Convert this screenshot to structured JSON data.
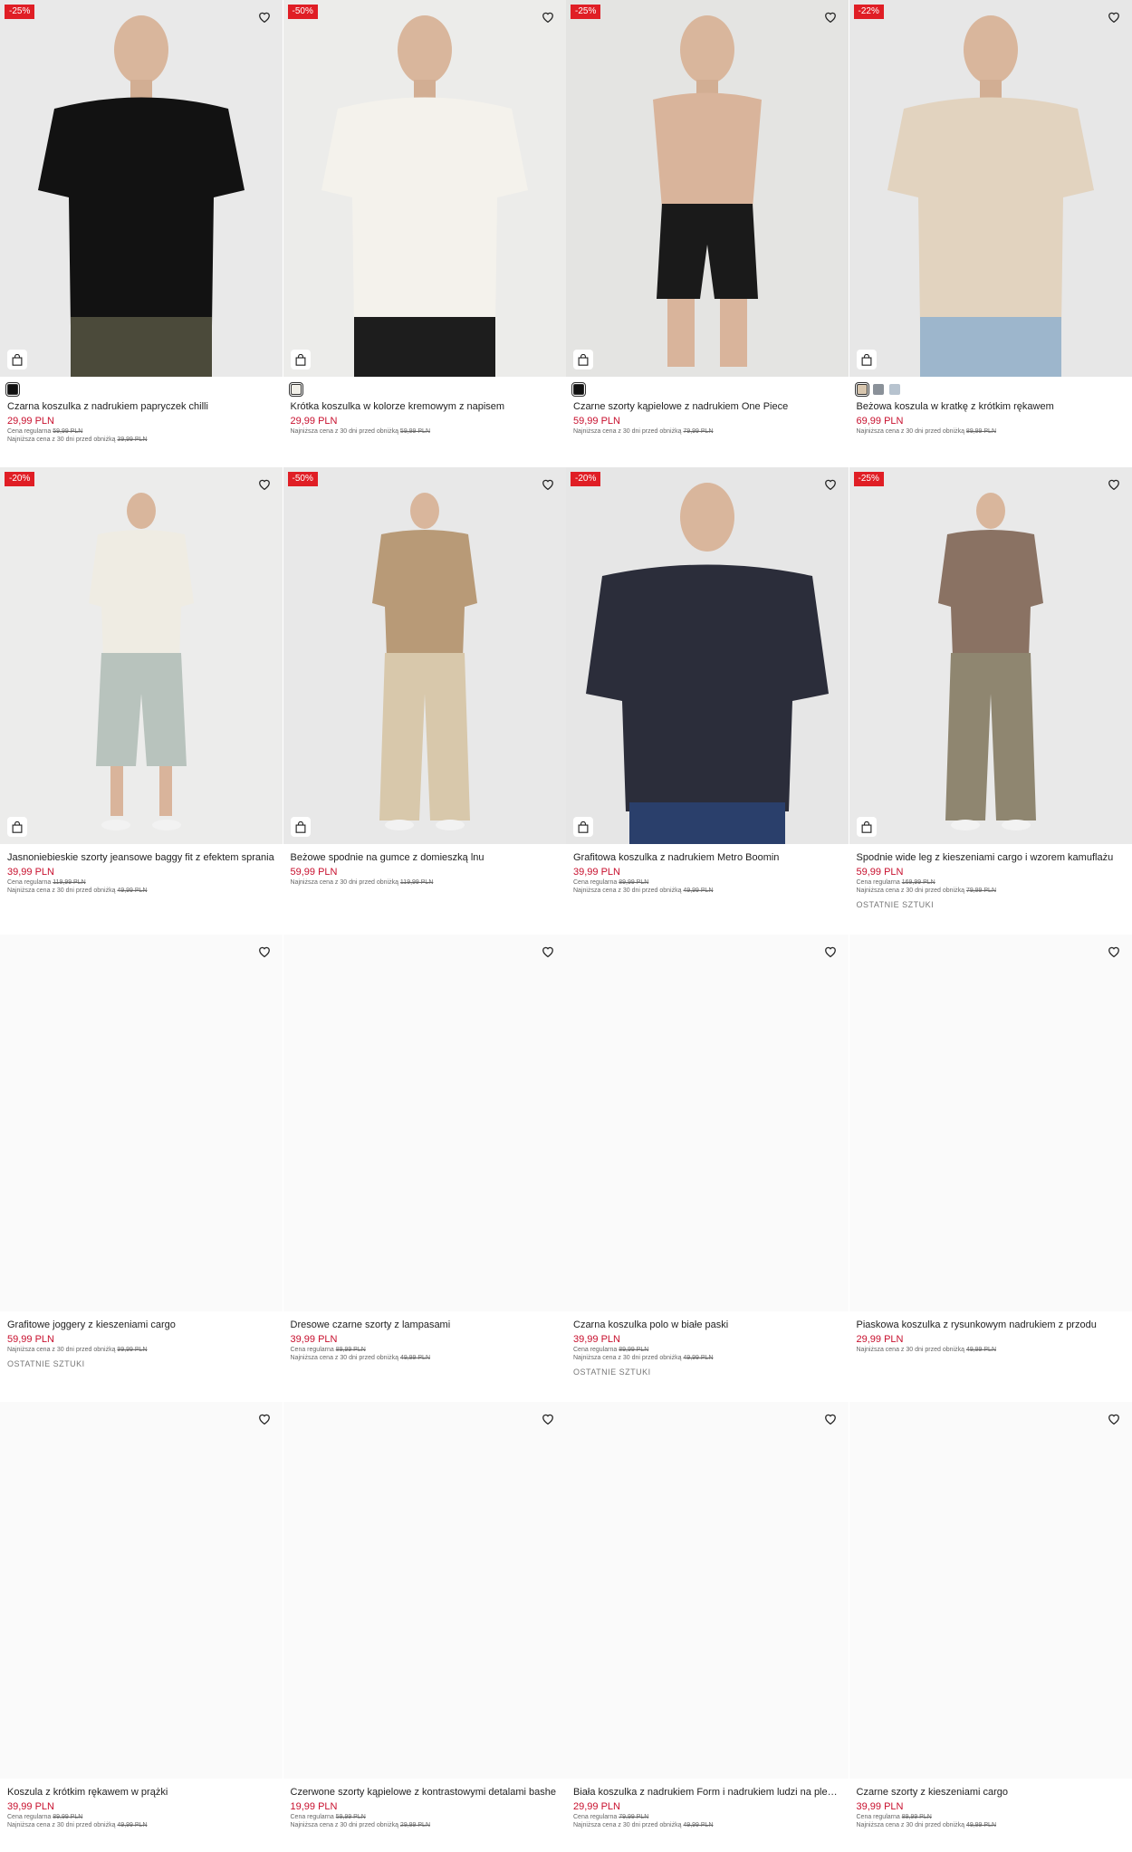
{
  "products": [
    {
      "badge": "-25%",
      "name": "Czarna koszulka z nadrukiem papryczek chilli",
      "price": "29,99 PLN",
      "regular_label": "Cena regularna",
      "regular": "59,99 PLN",
      "lowest_label": "Najniższa cena z 30 dni przed obniżką",
      "lowest": "39,99 PLN",
      "swatches": [
        "#111111"
      ],
      "bg": "#e9e9e9",
      "shirt": "#121212",
      "legs": "#4b4a3a",
      "note": ""
    },
    {
      "badge": "-50%",
      "name": "Krótka koszulka w kolorze kremowym z napisem",
      "price": "29,99 PLN",
      "regular_label": "",
      "regular": "",
      "lowest_label": "Najniższa cena z 30 dni przed obniżką",
      "lowest": "59,99 PLN",
      "swatches": [
        "#f1efe8"
      ],
      "bg": "#ececea",
      "shirt": "#f4f2ec",
      "legs": "#1d1d1d",
      "note": ""
    },
    {
      "badge": "-25%",
      "name": "Czarne szorty kąpielowe z nadrukiem One Piece",
      "price": "59,99 PLN",
      "regular_label": "",
      "regular": "",
      "lowest_label": "Najniższa cena z 30 dni przed obniżką",
      "lowest": "79,99 PLN",
      "swatches": [
        "#111111"
      ],
      "bg": "#e4e4e2",
      "shirt": "#d9b49b",
      "legs": "#1a1a1a",
      "note": ""
    },
    {
      "badge": "-22%",
      "name": "Beżowa koszula w kratkę z krótkim rękawem",
      "price": "69,99 PLN",
      "regular_label": "",
      "regular": "",
      "lowest_label": "Najniższa cena z 30 dni przed obniżką",
      "lowest": "89,99 PLN",
      "swatches": [
        "#d8c6ae",
        "#8a9199",
        "#b7c3cf"
      ],
      "bg": "#e7e7e7",
      "shirt": "#e2d3bf",
      "legs": "#9db6cc",
      "note": ""
    },
    {
      "badge": "-20%",
      "name": "Jasnoniebieskie szorty jeansowe baggy fit z efektem sprania",
      "price": "39,99 PLN",
      "regular_label": "Cena regularna",
      "regular": "119,99 PLN",
      "lowest_label": "Najniższa cena z 30 dni przed obniżką",
      "lowest": "49,99 PLN",
      "swatches": [],
      "bg": "#ececeb",
      "shirt": "#efece3",
      "legs": "#b8c3bd",
      "note": ""
    },
    {
      "badge": "-50%",
      "name": "Beżowe spodnie na gumce z domieszką lnu",
      "price": "59,99 PLN",
      "regular_label": "",
      "regular": "",
      "lowest_label": "Najniższa cena z 30 dni przed obniżką",
      "lowest": "119,99 PLN",
      "swatches": [],
      "bg": "#e8e8e8",
      "shirt": "#b89a77",
      "legs": "#d8c8ab",
      "note": ""
    },
    {
      "badge": "-20%",
      "name": "Grafitowa koszulka z nadrukiem Metro Boomin",
      "price": "39,99 PLN",
      "regular_label": "Cena regularna",
      "regular": "89,99 PLN",
      "lowest_label": "Najniższa cena z 30 dni przed obniżką",
      "lowest": "49,99 PLN",
      "swatches": [],
      "bg": "#e6e6e6",
      "shirt": "#2b2d3a",
      "legs": "#2a3f6b",
      "note": ""
    },
    {
      "badge": "-25%",
      "name": "Spodnie wide leg z kieszeniami cargo i wzorem kamuflażu",
      "price": "59,99 PLN",
      "regular_label": "Cena regularna",
      "regular": "169,99 PLN",
      "lowest_label": "Najniższa cena z 30 dni przed obniżką",
      "lowest": "79,99 PLN",
      "swatches": [],
      "bg": "#e9e9e9",
      "shirt": "#8a7263",
      "legs": "#8f8670",
      "note": "OSTATNIE SZTUKI"
    },
    {
      "badge": "",
      "name": "Grafitowe joggery z kieszeniami cargo",
      "price": "59,99 PLN",
      "regular_label": "",
      "regular": "",
      "lowest_label": "Najniższa cena z 30 dni przed obniżką",
      "lowest": "99,99 PLN",
      "swatches": [],
      "note": "OSTATNIE SZTUKI"
    },
    {
      "badge": "",
      "name": "Dresowe czarne szorty z lampasami",
      "price": "39,99 PLN",
      "regular_label": "Cena regularna",
      "regular": "89,99 PLN",
      "lowest_label": "Najniższa cena z 30 dni przed obniżką",
      "lowest": "49,99 PLN",
      "swatches": [],
      "note": ""
    },
    {
      "badge": "",
      "name": "Czarna koszulka polo w białe paski",
      "price": "39,99 PLN",
      "regular_label": "Cena regularna",
      "regular": "89,99 PLN",
      "lowest_label": "Najniższa cena z 30 dni przed obniżką",
      "lowest": "49,99 PLN",
      "swatches": [],
      "note": "OSTATNIE SZTUKI"
    },
    {
      "badge": "",
      "name": "Piaskowa koszulka z rysunkowym nadrukiem z przodu",
      "price": "29,99 PLN",
      "regular_label": "",
      "regular": "",
      "lowest_label": "Najniższa cena z 30 dni przed obniżką",
      "lowest": "49,99 PLN",
      "swatches": [],
      "note": ""
    },
    {
      "badge": "",
      "name": "Koszula z krótkim rękawem w prążki",
      "price": "39,99 PLN",
      "regular_label": "Cena regularna",
      "regular": "89,99 PLN",
      "lowest_label": "Najniższa cena z 30 dni przed obniżką",
      "lowest": "49,99 PLN",
      "swatches": [],
      "note": ""
    },
    {
      "badge": "",
      "name": "Czerwone szorty kąpielowe z kontrastowymi detalami bashe",
      "price": "19,99 PLN",
      "regular_label": "Cena regularna",
      "regular": "59,99 PLN",
      "lowest_label": "Najniższa cena z 30 dni przed obniżką",
      "lowest": "29,99 PLN",
      "swatches": [],
      "note": ""
    },
    {
      "badge": "",
      "name": "Biała koszulka z nadrukiem Form i nadrukiem ludzi na plecach",
      "price": "29,99 PLN",
      "regular_label": "Cena regularna",
      "regular": "79,99 PLN",
      "lowest_label": "Najniższa cena z 30 dni przed obniżką",
      "lowest": "49,99 PLN",
      "swatches": [],
      "note": ""
    },
    {
      "badge": "",
      "name": "Czarne szorty z kieszeniami cargo",
      "price": "39,99 PLN",
      "regular_label": "Cena regularna",
      "regular": "89,99 PLN",
      "lowest_label": "Najniższa cena z 30 dni przed obniżką",
      "lowest": "49,99 PLN",
      "swatches": [],
      "note": ""
    }
  ],
  "icons": {
    "wishlist": "heart-icon",
    "quick_add": "shopping-bag-icon"
  },
  "colors": {
    "sale_badge": "#e01e25",
    "price": "#c8102e"
  }
}
